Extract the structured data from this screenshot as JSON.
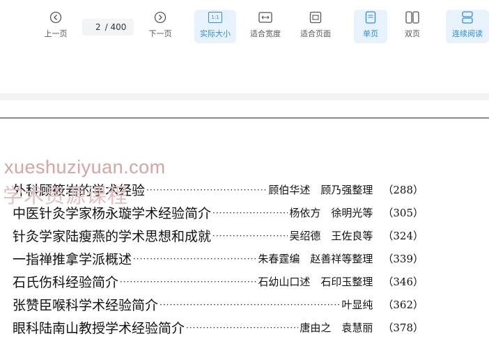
{
  "toolbar": {
    "prev_label": "上一页",
    "page_current": "2",
    "page_total": "/ 400",
    "next_label": "下一页",
    "actual_size_label": "实际大小",
    "actual_size_icon_text": "1:1",
    "fit_width_label": "适合宽度",
    "fit_page_label": "适合页面",
    "single_page_label": "单页",
    "double_page_label": "双页",
    "continuous_label": "连续阅读",
    "accent_color": "#2e8de0"
  },
  "watermark": {
    "url": "xueshuziyuan.com",
    "text": "学术资源课程"
  },
  "toc": {
    "entries": [
      {
        "title": "外科顾筱岩的学术经验",
        "author": "顾伯华述　顾乃强整理",
        "page": "（288）"
      },
      {
        "title": "中医针灸学家杨永璇学术经验简介",
        "author": "杨依方　徐明光等",
        "page": "（305）"
      },
      {
        "title": "针灸学家陆瘦燕的学术思想和成就",
        "author": "吴绍德　王佐良等",
        "page": "（324）"
      },
      {
        "title": "一指禅推拿学派概述",
        "author": "朱春霆编　赵善祥等整理",
        "page": "（339）"
      },
      {
        "title": "石氏伤科经验简介",
        "author": "石幼山口述　石印玉整理",
        "page": "（346）"
      },
      {
        "title": "张赞臣喉科学术经验简介",
        "author": "叶显纯",
        "page": "（362）"
      },
      {
        "title": "眼科陆南山教授学术经验简介",
        "author": "唐由之　袁慧丽",
        "page": "（378）"
      }
    ]
  }
}
